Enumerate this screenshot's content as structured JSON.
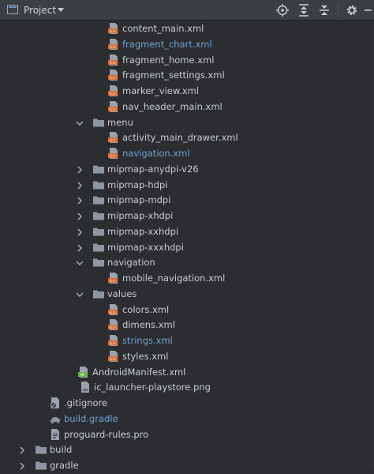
{
  "header": {
    "title": "Project",
    "icons": [
      "project-view-icon",
      "dropdown-arrow-icon",
      "locate-icon",
      "expand-all-icon",
      "collapse-all-icon",
      "gear-icon",
      "minimize-icon"
    ]
  },
  "colors": {
    "vcs_modified": "#6fa2d9",
    "folder": "#8d97a3",
    "xml_badge": "#d9703b",
    "manifest_badge": "#62b543"
  },
  "tree": [
    {
      "label": "content_main.xml",
      "depth": 4,
      "icon": "xml-file-icon",
      "vcs": false
    },
    {
      "label": "fragment_chart.xml",
      "depth": 4,
      "icon": "xml-file-icon",
      "vcs": true
    },
    {
      "label": "fragment_home.xml",
      "depth": 4,
      "icon": "xml-file-icon",
      "vcs": false
    },
    {
      "label": "fragment_settings.xml",
      "depth": 4,
      "icon": "xml-file-icon",
      "vcs": false
    },
    {
      "label": "marker_view.xml",
      "depth": 4,
      "icon": "xml-file-icon",
      "vcs": false
    },
    {
      "label": "nav_header_main.xml",
      "depth": 4,
      "icon": "xml-file-icon",
      "vcs": false
    },
    {
      "label": "menu",
      "depth": 3,
      "icon": "folder-icon",
      "expanded": true
    },
    {
      "label": "activity_main_drawer.xml",
      "depth": 4,
      "icon": "xml-file-icon",
      "vcs": false
    },
    {
      "label": "navigation.xml",
      "depth": 4,
      "icon": "xml-file-icon",
      "vcs": true
    },
    {
      "label": "mipmap-anydpi-v26",
      "depth": 3,
      "icon": "folder-icon",
      "expanded": false
    },
    {
      "label": "mipmap-hdpi",
      "depth": 3,
      "icon": "folder-icon",
      "expanded": false
    },
    {
      "label": "mipmap-mdpi",
      "depth": 3,
      "icon": "folder-icon",
      "expanded": false
    },
    {
      "label": "mipmap-xhdpi",
      "depth": 3,
      "icon": "folder-icon",
      "expanded": false
    },
    {
      "label": "mipmap-xxhdpi",
      "depth": 3,
      "icon": "folder-icon",
      "expanded": false
    },
    {
      "label": "mipmap-xxxhdpi",
      "depth": 3,
      "icon": "folder-icon",
      "expanded": false
    },
    {
      "label": "navigation",
      "depth": 3,
      "icon": "folder-icon",
      "expanded": true
    },
    {
      "label": "mobile_navigation.xml",
      "depth": 4,
      "icon": "xml-file-icon",
      "vcs": false
    },
    {
      "label": "values",
      "depth": 3,
      "icon": "folder-icon",
      "expanded": true
    },
    {
      "label": "colors.xml",
      "depth": 4,
      "icon": "xml-file-icon",
      "vcs": false
    },
    {
      "label": "dimens.xml",
      "depth": 4,
      "icon": "xml-file-icon",
      "vcs": false
    },
    {
      "label": "strings.xml",
      "depth": 4,
      "icon": "xml-file-icon",
      "vcs": true
    },
    {
      "label": "styles.xml",
      "depth": 4,
      "icon": "xml-file-icon",
      "vcs": false
    },
    {
      "label": "AndroidManifest.xml",
      "depth": 3,
      "icon": "manifest-file-icon",
      "vcs": false
    },
    {
      "label": "ic_launcher-playstore.png",
      "depth": 3,
      "icon": "image-file-icon",
      "vcs": false
    },
    {
      "label": ".gitignore",
      "depth": 2,
      "icon": "gitignore-file-icon",
      "vcs": false
    },
    {
      "label": "build.gradle",
      "depth": 2,
      "icon": "gradle-file-icon",
      "vcs": true
    },
    {
      "label": "proguard-rules.pro",
      "depth": 2,
      "icon": "text-file-icon",
      "vcs": false
    },
    {
      "label": "build",
      "depth": 1,
      "icon": "folder-icon",
      "expanded": false
    },
    {
      "label": "gradle",
      "depth": 1,
      "icon": "folder-icon",
      "expanded": false
    }
  ]
}
